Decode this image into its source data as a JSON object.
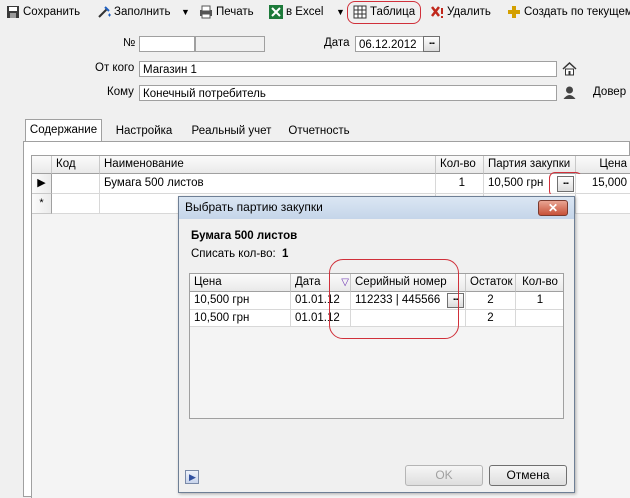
{
  "toolbar": {
    "save": "Сохранить",
    "fill": "Заполнить",
    "print": "Печать",
    "excel": "в Excel",
    "table": "Таблица",
    "delete": "Удалить",
    "create_based": "Создать по текущему"
  },
  "header": {
    "number_label": "№",
    "number_value": "",
    "date_label": "Дата",
    "date_value": "06.12.2012",
    "from_label": "От кого",
    "from_value": "Магазин 1",
    "to_label": "Кому",
    "to_value": "Конечный потребитель",
    "trust_label": "Довер"
  },
  "tabs": [
    "Содержание",
    "Настройка",
    "Реальный учет",
    "Отчетность"
  ],
  "grid": {
    "columns": [
      "Код",
      "Наименование",
      "Кол-во",
      "Партия закупки",
      "Цена"
    ],
    "rows": [
      {
        "code": "",
        "name": "Бумага 500 листов",
        "qty": "1",
        "batch": "10,500 грн",
        "price": "15,000"
      }
    ],
    "new_row_marker": "*",
    "current_row_marker": "▶"
  },
  "dialog": {
    "title": "Выбрать партию закупки",
    "product": "Бумага 500 листов",
    "writeoff_label": "Списать кол-во:",
    "writeoff_value": "1",
    "columns": [
      "Цена",
      "Дата",
      "Серийный номер",
      "Остаток",
      "Кол-во"
    ],
    "rows": [
      {
        "price": "10,500 грн",
        "date": "01.01.12",
        "serial": "112233 | 445566",
        "rest": "2",
        "qty": "1"
      },
      {
        "price": "10,500 грн",
        "date": "01.01.12",
        "serial": "",
        "rest": "2",
        "qty": ""
      }
    ],
    "ok": "OK",
    "cancel": "Отмена"
  },
  "colors": {
    "highlight": "#d0303a",
    "title_bar": "#c5d5e9",
    "close_button": "#c75138"
  }
}
